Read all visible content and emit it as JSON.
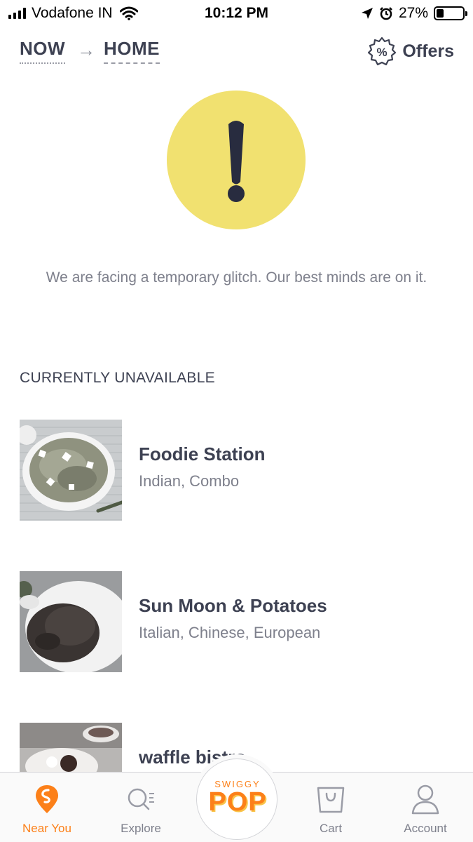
{
  "status_bar": {
    "carrier": "Vodafone IN",
    "time": "10:12 PM",
    "battery": "27%",
    "battery_level": 0.27
  },
  "header": {
    "location_from": "NOW",
    "location_to": "HOME",
    "offers_label": "Offers"
  },
  "error": {
    "message": "We are facing a temporary glitch. Our best minds are on it."
  },
  "section": {
    "title": "CURRENTLY UNAVAILABLE"
  },
  "restaurants": [
    {
      "name": "Foodie Station",
      "cuisine": "Indian, Combo"
    },
    {
      "name": "Sun Moon & Potatoes",
      "cuisine": "Italian, Chinese, European"
    },
    {
      "name": "waffle bistro",
      "cuisine": ""
    }
  ],
  "bottom_nav": {
    "items": [
      {
        "label": "Near You",
        "icon": "swiggy-logo-icon",
        "active": true
      },
      {
        "label": "Explore",
        "icon": "search-icon",
        "active": false
      },
      {
        "label": "Cart",
        "icon": "bag-icon",
        "active": false
      },
      {
        "label": "Account",
        "icon": "person-icon",
        "active": false
      }
    ],
    "pop": {
      "small": "SWIGGY",
      "big": "POP"
    }
  },
  "colors": {
    "accent": "#fc8019",
    "warning_yellow": "#f1e170",
    "text_dark": "#3d4152",
    "text_muted": "#7e808c"
  }
}
